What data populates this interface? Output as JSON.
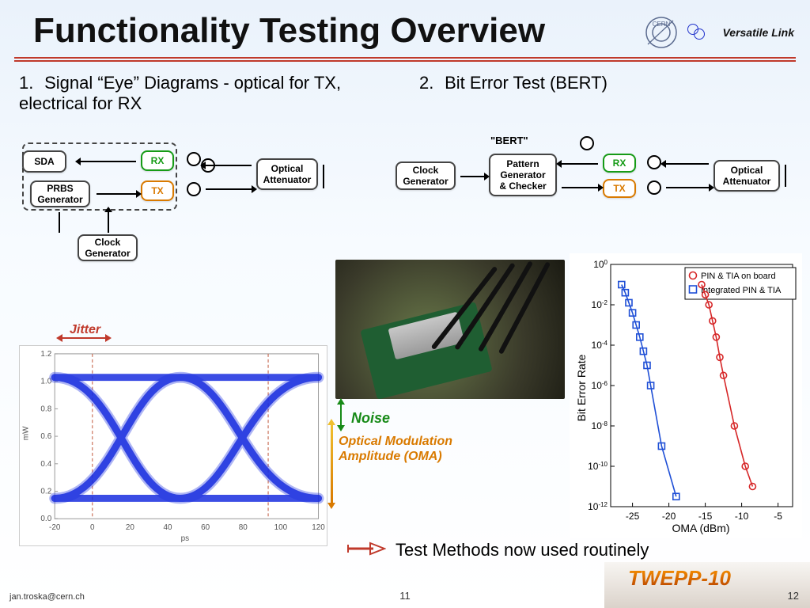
{
  "title": "Functionality Testing Overview",
  "header": {
    "brand": "Versatile Link",
    "logo_label": "CERN"
  },
  "items": {
    "one": {
      "num": "1.",
      "text": "Signal “Eye” Diagrams - optical for TX, electrical for RX"
    },
    "two": {
      "num": "2.",
      "text": "Bit Error Test (BERT)"
    }
  },
  "diagram1": {
    "sda": "SDA",
    "prbs": "PRBS\nGenerator",
    "clock": "Clock\nGenerator",
    "rx": "RX",
    "tx": "TX",
    "opt_att": "Optical\nAttenuator"
  },
  "diagram2": {
    "bert_label": "\"BERT\"",
    "clock": "Clock\nGenerator",
    "pattern": "Pattern\nGenerator\n& Checker",
    "rx": "RX",
    "tx": "TX",
    "opt_att": "Optical\nAttenuator"
  },
  "annotations": {
    "jitter": "Jitter",
    "noise": "Noise",
    "oma": "Optical Modulation\nAmplitude (OMA)"
  },
  "routinely": "Test Methods now used routinely",
  "eye_chart": {
    "ylabel": "mW",
    "yticks": [
      "0.0",
      "0.2",
      "0.4",
      "0.6",
      "0.8",
      "1.0",
      "1.2"
    ],
    "xlabel": "ps",
    "xticks": [
      "-20",
      "0",
      "20",
      "40",
      "60",
      "80",
      "100",
      "120"
    ]
  },
  "chart_data": {
    "type": "line",
    "title": "",
    "xlabel": "OMA (dBm)",
    "ylabel": "Bit Error Rate",
    "ylim_exp": [
      -12,
      0
    ],
    "xlim": [
      -28,
      -3
    ],
    "xticks": [
      -25,
      -20,
      -15,
      -10,
      -5
    ],
    "ytick_exp": [
      0,
      -2,
      -4,
      -6,
      -8,
      -10,
      -12
    ],
    "series": [
      {
        "name": "PIN & TIA on board",
        "marker": "circle",
        "color": "#d62728",
        "x": [
          -15.5,
          -15.0,
          -14.5,
          -14.0,
          -13.5,
          -13.0,
          -12.5,
          -11.0,
          -9.5,
          -8.5
        ],
        "y_exp": [
          -1.0,
          -1.5,
          -2.0,
          -2.8,
          -3.6,
          -4.6,
          -5.5,
          -8.0,
          -10.0,
          -11.0
        ]
      },
      {
        "name": "Integrated PIN & TIA",
        "marker": "square",
        "color": "#1f4fd6",
        "x": [
          -26.5,
          -26.0,
          -25.5,
          -25.0,
          -24.5,
          -24.0,
          -23.5,
          -23.0,
          -22.5,
          -21.0,
          -19.0
        ],
        "y_exp": [
          -1.0,
          -1.4,
          -1.9,
          -2.4,
          -3.0,
          -3.6,
          -4.3,
          -5.0,
          -6.0,
          -9.0,
          -11.5
        ]
      }
    ]
  },
  "footer": {
    "left": "jan.troska@cern.ch",
    "center": "11",
    "right": "12",
    "conference": "TWEPP-10"
  }
}
